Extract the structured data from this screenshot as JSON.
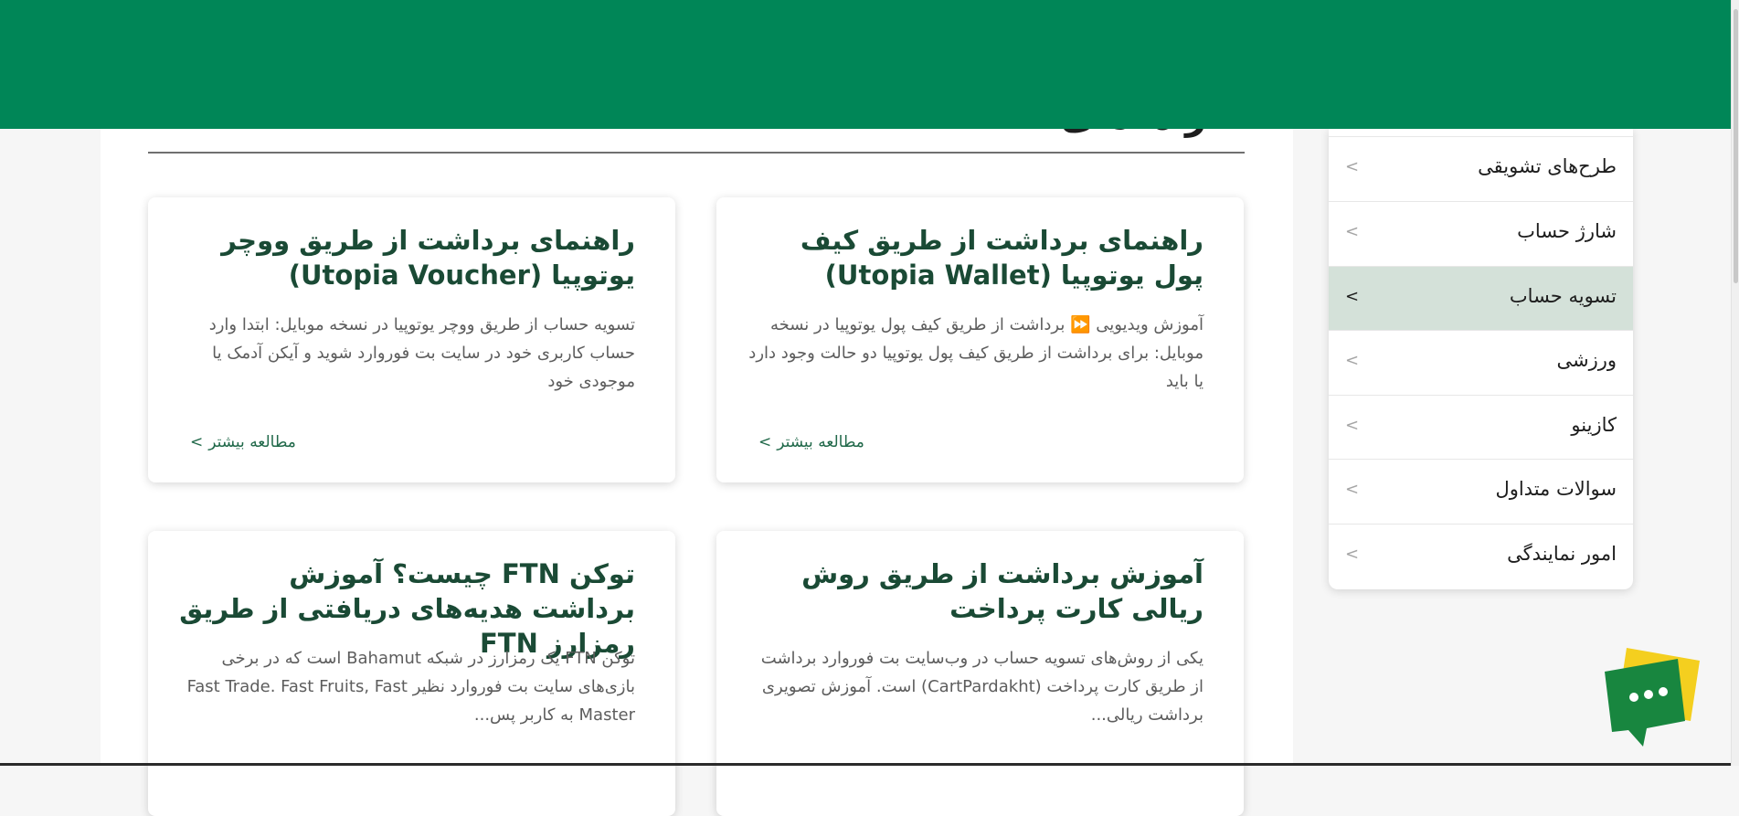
{
  "header": {
    "title_fragment": "راهنمای"
  },
  "sidebar": {
    "items": [
      {
        "label": "طرح‌های تشویقی",
        "active": false
      },
      {
        "label": "شارژ حساب",
        "active": false
      },
      {
        "label": "تسویه حساب",
        "active": true
      },
      {
        "label": "ورزشی",
        "active": false
      },
      {
        "label": "کازینو",
        "active": false
      },
      {
        "label": "سوالات متداول",
        "active": false
      },
      {
        "label": "امور نمایندگی",
        "active": false
      }
    ],
    "chevron": ">"
  },
  "cards": [
    {
      "title": "راهنمای برداشت از طریق کیف پول یوتوپیا (Utopia Wallet)",
      "excerpt": "آموزش ویدیویی ⏩ برداشت از طریق کیف پول یوتوپیا در نسخه موبایل: برای برداشت از طریق کیف پول یوتوپیا دو حالت وجود دارد یا باید",
      "read_more": "مطالعه بیشتر"
    },
    {
      "title": "راهنمای برداشت از طریق ووچر یوتوپیا (Utopia Voucher)",
      "excerpt": "تسویه حساب از طریق ووچر یوتوپیا در نسخه موبایل: ابتدا وارد حساب کاربری خود در سایت بت فوروارد شوید و آیکن آدمک یا موجودی خود",
      "read_more": "مطالعه بیشتر"
    },
    {
      "title": "آموزش برداشت از طریق روش ریالی کارت پرداخت",
      "excerpt": "یکی از روش‌های تسویه حساب در وب‌سایت بت فوروارد برداشت از طریق کارت پرداخت (CartPardakht) است. آموزش تصویری برداشت ریالی...",
      "read_more": ""
    },
    {
      "title": "توکن FTN چیست؟ آموزش برداشت هدیه‌های دریافتی از طریق رمزارز FTN",
      "excerpt": "توکن FTN یک رمزارز در شبکه Bahamut است که در برخی بازی‌های سایت بت فوروارد نظیر Fast Trade. Fast Fruits, Fast Master به کاربر پس...",
      "read_more": ""
    }
  ],
  "read_more_arrow": ">",
  "colors": {
    "brand_green": "#008657",
    "card_title": "#1a4a35",
    "link": "#21694a",
    "active_item_bg": "#d4e1d9",
    "chat_yellow": "#f4cf1f",
    "chat_green": "#18863f"
  },
  "icons": {
    "chat": "chat-bubble-icon",
    "chevron": "chevron-left-icon"
  }
}
